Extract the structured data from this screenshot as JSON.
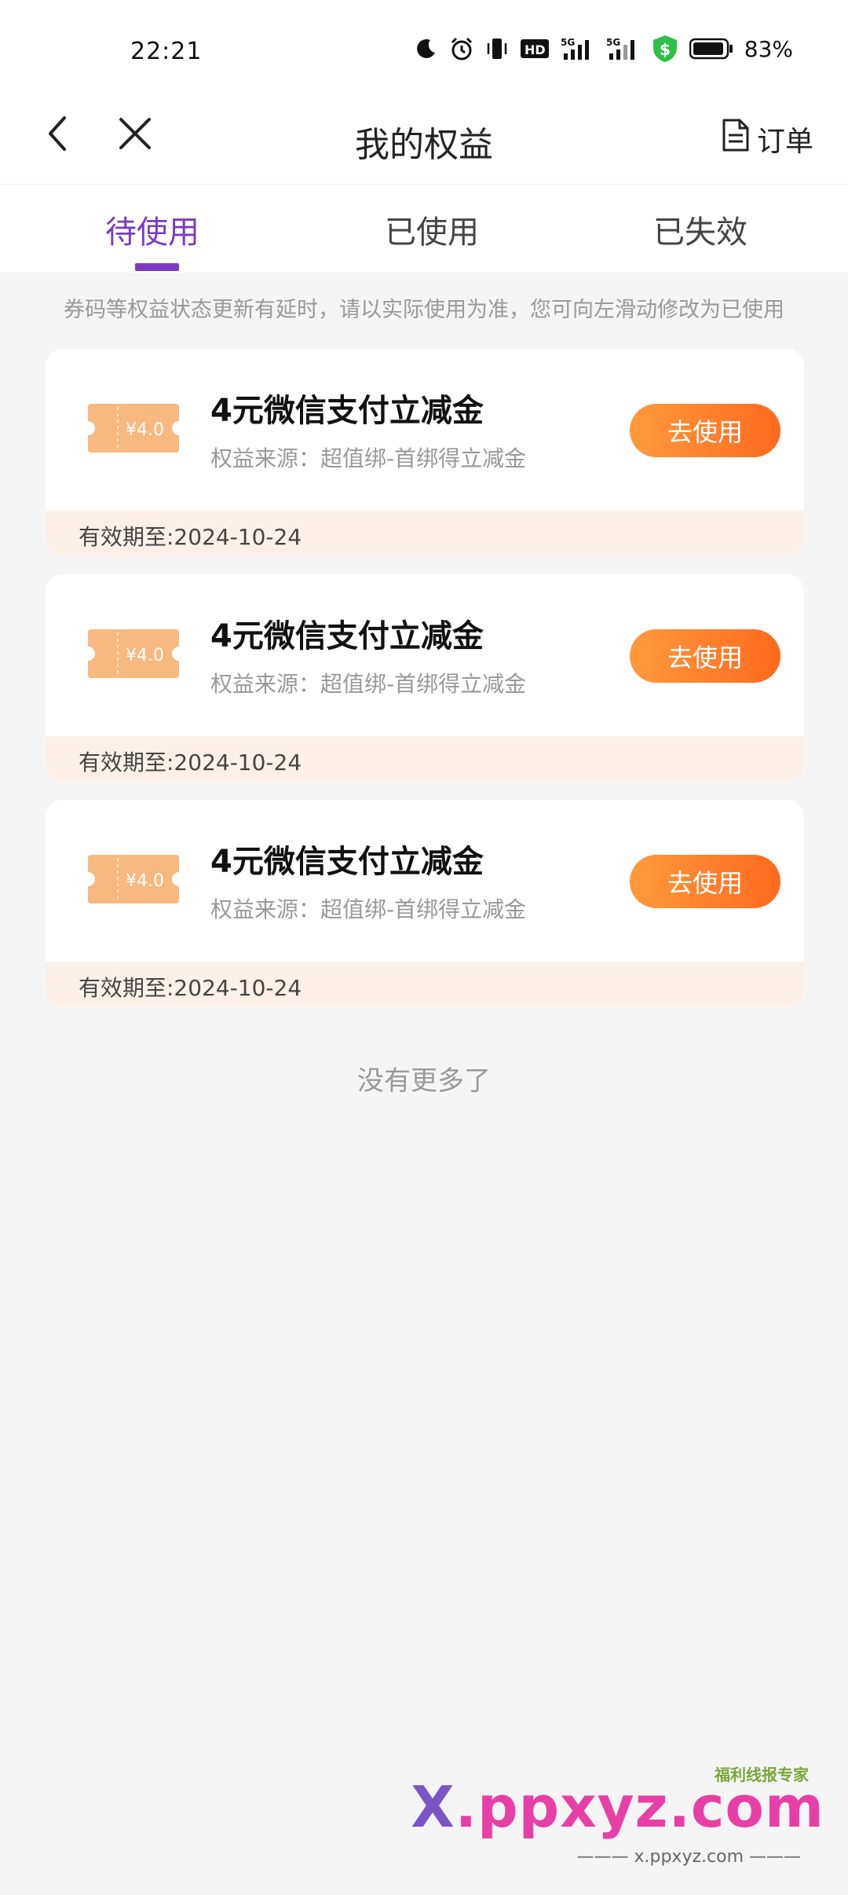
{
  "status_bar": {
    "time": "22:21",
    "battery": "83%",
    "icons": [
      "moon-icon",
      "alarm-icon",
      "vibrate-icon",
      "hd-icon",
      "signal-5g-icon",
      "signal-5g-icon",
      "shield-dollar-icon",
      "battery-icon"
    ]
  },
  "header": {
    "title": "我的权益",
    "order_label": "订单",
    "colors": {
      "accent": "#7a3cc2"
    }
  },
  "tabs": [
    {
      "label": "待使用",
      "active": true
    },
    {
      "label": "已使用",
      "active": false
    },
    {
      "label": "已失效",
      "active": false
    }
  ],
  "notice": "券码等权益状态更新有延时，请以实际使用为准，您可向左滑动修改为已使用",
  "coupons": [
    {
      "icon_value": "¥4.0",
      "title": "4元微信支付立减金",
      "source": "权益来源：超值绑-首绑得立减金",
      "button": "去使用",
      "expiry": "有效期至:2024-10-24"
    },
    {
      "icon_value": "¥4.0",
      "title": "4元微信支付立减金",
      "source": "权益来源：超值绑-首绑得立减金",
      "button": "去使用",
      "expiry": "有效期至:2024-10-24"
    },
    {
      "icon_value": "¥4.0",
      "title": "4元微信支付立减金",
      "source": "权益来源：超值绑-首绑得立减金",
      "button": "去使用",
      "expiry": "有效期至:2024-10-24"
    }
  ],
  "no_more": "没有更多了",
  "watermark": {
    "tag": "福利线报专家",
    "main_x": "X",
    "main_rest": ".ppxyz.com",
    "sub": "——— x.ppxyz.com ———"
  }
}
